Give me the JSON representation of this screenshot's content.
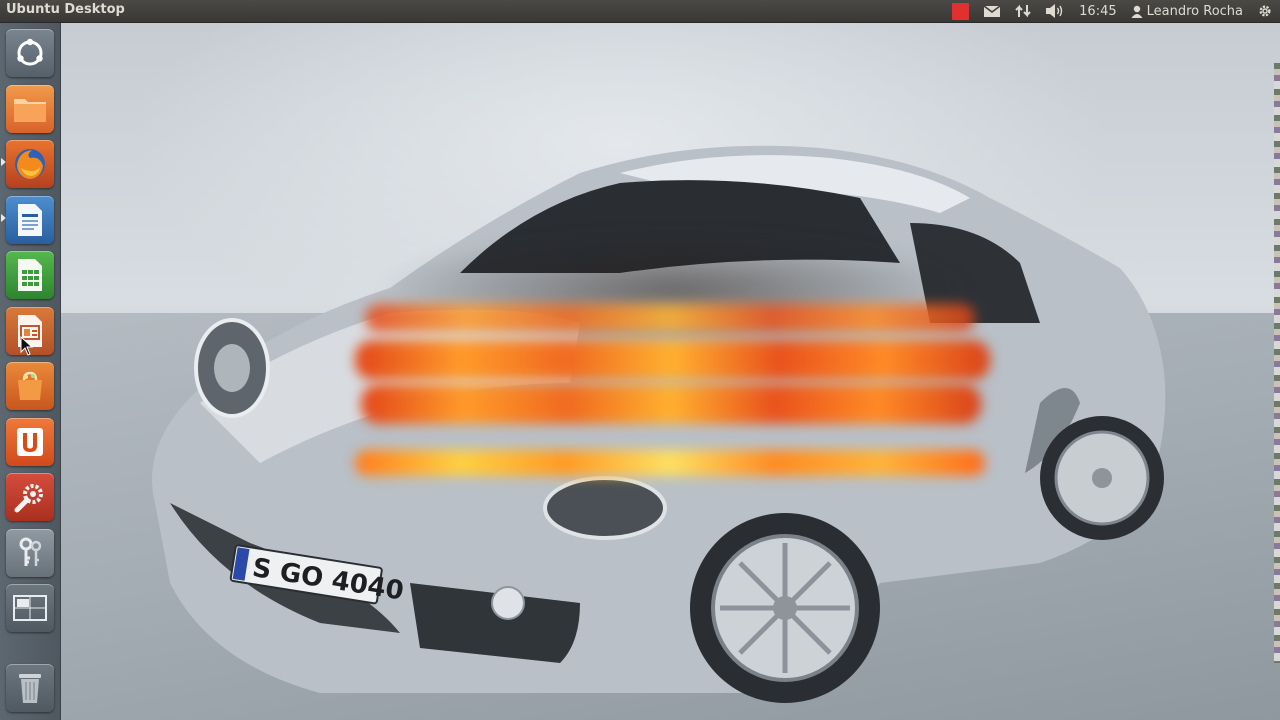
{
  "panel": {
    "title": "Ubuntu Desktop",
    "clock": "16:45",
    "user": "Leandro Rocha"
  },
  "colors": {
    "panel_bg": "#3f3e3b",
    "launcher_bg": "#566068",
    "record_indicator": "#e03030"
  },
  "launcher": {
    "items": [
      {
        "name": "dash-home-icon"
      },
      {
        "name": "files-icon"
      },
      {
        "name": "firefox-icon"
      },
      {
        "name": "libreoffice-writer-icon"
      },
      {
        "name": "libreoffice-calc-icon"
      },
      {
        "name": "libreoffice-impress-icon"
      },
      {
        "name": "software-center-icon"
      },
      {
        "name": "ubuntu-one-icon"
      },
      {
        "name": "system-settings-icon"
      },
      {
        "name": "passwords-keys-icon"
      },
      {
        "name": "workspace-switcher-icon"
      },
      {
        "name": "trash-icon"
      }
    ]
  },
  "wallpaper": {
    "plate_text": "S GO 4040"
  }
}
